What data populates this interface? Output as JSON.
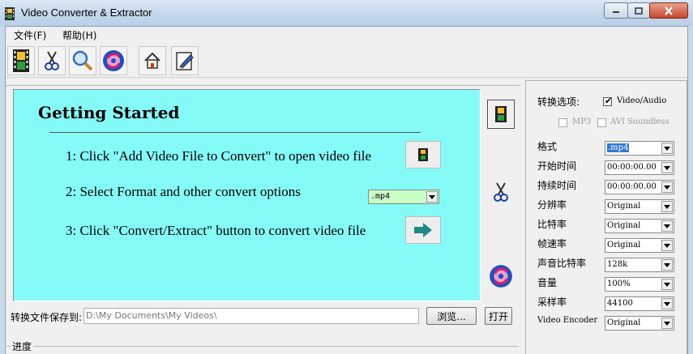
{
  "window": {
    "title": "Video Converter & Extractor"
  },
  "menu": {
    "file": "文件(F)",
    "help": "帮助(H)"
  },
  "getting_started": {
    "title": "Getting Started",
    "step1": "1: Click \"Add Video File to Convert\" to open video file",
    "step2": "2: Select Format and other convert options",
    "step3": "3: Click \"Convert/Extract\" button to convert video file",
    "format_value": ".mp4"
  },
  "save": {
    "label": "转换文件保存到:",
    "path": "D:\\My Documents\\My Videos\\",
    "browse": "浏览...",
    "open": "打开"
  },
  "progress": {
    "label": "进度"
  },
  "options": {
    "title": "转换选项:",
    "video_audio": "Video/Audio",
    "mp3": "MP3",
    "avi_soundless": "AVI Soundless",
    "rows": [
      {
        "label": "格式",
        "value": ".mp4"
      },
      {
        "label": "开始时间",
        "value": "00:00:00.00"
      },
      {
        "label": "持续时间",
        "value": "00:00:00.00"
      },
      {
        "label": "分辨率",
        "value": "Original"
      },
      {
        "label": "比特率",
        "value": "Original"
      },
      {
        "label": "帧速率",
        "value": "Original"
      },
      {
        "label": "声音比特率",
        "value": "128k"
      },
      {
        "label": "音量",
        "value": "100%"
      },
      {
        "label": "采样率",
        "value": "44100"
      },
      {
        "label": "Video Encoder",
        "value": "Original"
      }
    ]
  },
  "colors": {
    "panel_bg": "#85fbf8",
    "format_bg": "#c7ffc7",
    "selection": "#3178d6"
  }
}
